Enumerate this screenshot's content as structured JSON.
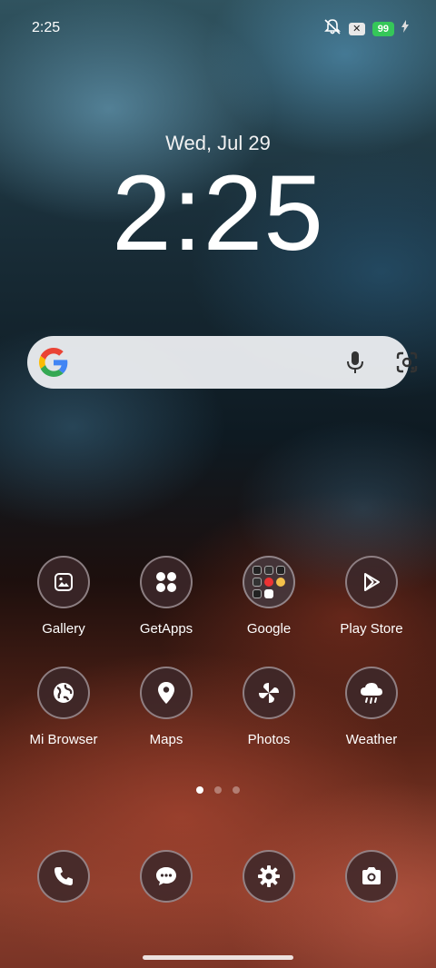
{
  "status_bar": {
    "time": "2:25",
    "battery": "99",
    "icons": [
      "mute-icon",
      "sim-x-icon",
      "battery-icon",
      "charging-icon"
    ]
  },
  "lock_clock": {
    "date": "Wed, Jul 29",
    "time": "2:25"
  },
  "search_bar": {
    "icons": [
      "google-logo-icon",
      "mic-icon",
      "lens-camera-icon"
    ]
  },
  "home": {
    "row1": [
      {
        "label": "Gallery",
        "icon": "gallery-icon"
      },
      {
        "label": "GetApps",
        "icon": "getapps-icon"
      },
      {
        "label": "Google",
        "icon": "folder-icon"
      },
      {
        "label": "Play Store",
        "icon": "play-store-icon"
      }
    ],
    "row2": [
      {
        "label": "Mi Browser",
        "icon": "globe-icon"
      },
      {
        "label": "Maps",
        "icon": "map-pin-icon"
      },
      {
        "label": "Photos",
        "icon": "pinwheel-icon"
      },
      {
        "label": "Weather",
        "icon": "cloud-rain-icon"
      }
    ],
    "page_count": 3,
    "current_page": 1
  },
  "dock": [
    {
      "icon": "phone-icon"
    },
    {
      "icon": "messages-icon"
    },
    {
      "icon": "settings-icon"
    },
    {
      "icon": "camera-icon"
    }
  ],
  "colors": {
    "battery": "#35c759",
    "google_blue": "#4285F4",
    "google_red": "#EA4335",
    "google_yellow": "#FBBC05",
    "google_green": "#34A853"
  }
}
